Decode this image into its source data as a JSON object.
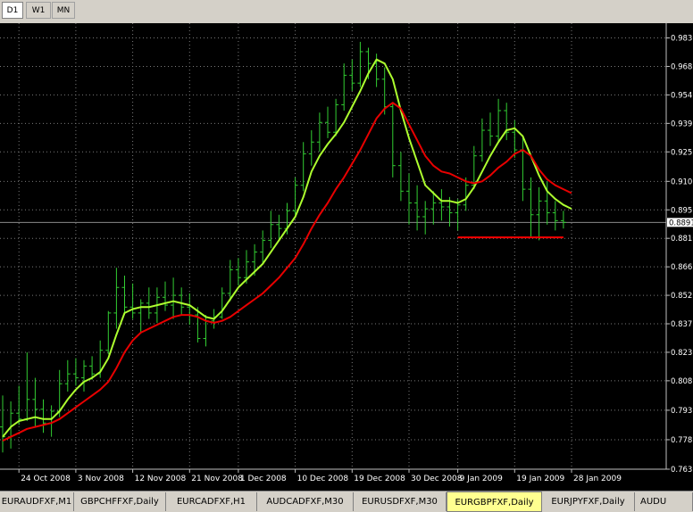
{
  "toolbar": {
    "timeframes": [
      {
        "label": "D1",
        "active": true
      },
      {
        "label": "W1",
        "active": false
      },
      {
        "label": "MN",
        "active": false
      }
    ]
  },
  "chart_data": {
    "type": "line",
    "symbol": "EURGBPFXF",
    "period": "Daily",
    "current_price": "0.8891",
    "ylim": [
      0.7635,
      0.9905
    ],
    "y_ticks": [
      "0.9830",
      "0.9685",
      "0.9540",
      "0.9395",
      "0.9250",
      "0.9100",
      "0.8955",
      "0.8810",
      "0.8665",
      "0.8520",
      "0.8375",
      "0.8230",
      "0.8085",
      "0.7935",
      "0.7785",
      "0.7635"
    ],
    "x_ticks": [
      {
        "bar": 2,
        "label": "24 Oct 2008"
      },
      {
        "bar": 9,
        "label": "3 Nov 2008"
      },
      {
        "bar": 16,
        "label": "12 Nov 2008"
      },
      {
        "bar": 23,
        "label": "21 Nov 2008"
      },
      {
        "bar": 29,
        "label": "1 Dec 2008"
      },
      {
        "bar": 36,
        "label": "10 Dec 2008"
      },
      {
        "bar": 43,
        "label": "19 Dec 2008"
      },
      {
        "bar": 50,
        "label": "30 Dec 2008"
      },
      {
        "bar": 56,
        "label": "9 Jan 2009"
      },
      {
        "bar": 63,
        "label": "19 Jan 2009"
      },
      {
        "bar": 70,
        "label": "28 Jan 2009"
      }
    ],
    "candles": [
      [
        0.785,
        0.801,
        0.772,
        0.78
      ],
      [
        0.78,
        0.798,
        0.774,
        0.792
      ],
      [
        0.792,
        0.806,
        0.786,
        0.789
      ],
      [
        0.789,
        0.823,
        0.788,
        0.799
      ],
      [
        0.799,
        0.81,
        0.785,
        0.794
      ],
      [
        0.794,
        0.799,
        0.782,
        0.787
      ],
      [
        0.787,
        0.796,
        0.78,
        0.793
      ],
      [
        0.793,
        0.814,
        0.79,
        0.807
      ],
      [
        0.807,
        0.819,
        0.803,
        0.812
      ],
      [
        0.812,
        0.82,
        0.806,
        0.81
      ],
      [
        0.81,
        0.819,
        0.803,
        0.816
      ],
      [
        0.816,
        0.821,
        0.809,
        0.812
      ],
      [
        0.812,
        0.829,
        0.81,
        0.824
      ],
      [
        0.824,
        0.844,
        0.822,
        0.843
      ],
      [
        0.843,
        0.866,
        0.835,
        0.856
      ],
      [
        0.856,
        0.862,
        0.842,
        0.846
      ],
      [
        0.846,
        0.858,
        0.84,
        0.843
      ],
      [
        0.843,
        0.85,
        0.833,
        0.848
      ],
      [
        0.848,
        0.856,
        0.84,
        0.843
      ],
      [
        0.843,
        0.856,
        0.838,
        0.851
      ],
      [
        0.851,
        0.859,
        0.844,
        0.847
      ],
      [
        0.847,
        0.861,
        0.84,
        0.852
      ],
      [
        0.852,
        0.856,
        0.842,
        0.846
      ],
      [
        0.846,
        0.853,
        0.837,
        0.842
      ],
      [
        0.842,
        0.846,
        0.828,
        0.83
      ],
      [
        0.83,
        0.842,
        0.826,
        0.839
      ],
      [
        0.839,
        0.845,
        0.835,
        0.841
      ],
      [
        0.841,
        0.856,
        0.84,
        0.853
      ],
      [
        0.853,
        0.87,
        0.849,
        0.865
      ],
      [
        0.865,
        0.871,
        0.857,
        0.861
      ],
      [
        0.861,
        0.875,
        0.858,
        0.869
      ],
      [
        0.869,
        0.878,
        0.862,
        0.874
      ],
      [
        0.874,
        0.885,
        0.868,
        0.88
      ],
      [
        0.88,
        0.895,
        0.876,
        0.888
      ],
      [
        0.888,
        0.893,
        0.88,
        0.886
      ],
      [
        0.886,
        0.899,
        0.883,
        0.895
      ],
      [
        0.895,
        0.912,
        0.893,
        0.908
      ],
      [
        0.908,
        0.93,
        0.905,
        0.924
      ],
      [
        0.924,
        0.936,
        0.918,
        0.93
      ],
      [
        0.93,
        0.945,
        0.925,
        0.94
      ],
      [
        0.94,
        0.948,
        0.932,
        0.935
      ],
      [
        0.935,
        0.952,
        0.933,
        0.949
      ],
      [
        0.949,
        0.97,
        0.946,
        0.964
      ],
      [
        0.964,
        0.972,
        0.956,
        0.96
      ],
      [
        0.96,
        0.981,
        0.958,
        0.976
      ],
      [
        0.976,
        0.978,
        0.962,
        0.97
      ],
      [
        0.97,
        0.975,
        0.958,
        0.962
      ],
      [
        0.962,
        0.968,
        0.944,
        0.948
      ],
      [
        0.948,
        0.95,
        0.912,
        0.918
      ],
      [
        0.918,
        0.925,
        0.9,
        0.905
      ],
      [
        0.905,
        0.914,
        0.888,
        0.899
      ],
      [
        0.899,
        0.908,
        0.885,
        0.892
      ],
      [
        0.892,
        0.9,
        0.883,
        0.896
      ],
      [
        0.896,
        0.905,
        0.888,
        0.899
      ],
      [
        0.899,
        0.906,
        0.89,
        0.897
      ],
      [
        0.897,
        0.902,
        0.887,
        0.894
      ],
      [
        0.894,
        0.901,
        0.885,
        0.898
      ],
      [
        0.898,
        0.912,
        0.895,
        0.908
      ],
      [
        0.908,
        0.928,
        0.906,
        0.923
      ],
      [
        0.923,
        0.942,
        0.92,
        0.936
      ],
      [
        0.936,
        0.945,
        0.928,
        0.933
      ],
      [
        0.933,
        0.952,
        0.93,
        0.946
      ],
      [
        0.946,
        0.95,
        0.931,
        0.935
      ],
      [
        0.935,
        0.941,
        0.922,
        0.926
      ],
      [
        0.926,
        0.933,
        0.9,
        0.906
      ],
      [
        0.906,
        0.912,
        0.882,
        0.893
      ],
      [
        0.893,
        0.907,
        0.88,
        0.9
      ],
      [
        0.9,
        0.91,
        0.888,
        0.894
      ],
      [
        0.894,
        0.9,
        0.885,
        0.89
      ],
      [
        0.89,
        0.895,
        0.886,
        0.8891
      ]
    ],
    "series": [
      {
        "color": "#adff2f",
        "values": [
          0.78,
          0.785,
          0.788,
          0.789,
          0.79,
          0.789,
          0.789,
          0.793,
          0.799,
          0.804,
          0.808,
          0.81,
          0.813,
          0.82,
          0.832,
          0.843,
          0.845,
          0.846,
          0.846,
          0.847,
          0.848,
          0.849,
          0.848,
          0.847,
          0.844,
          0.841,
          0.84,
          0.844,
          0.85,
          0.856,
          0.86,
          0.864,
          0.868,
          0.874,
          0.88,
          0.886,
          0.892,
          0.902,
          0.915,
          0.923,
          0.929,
          0.934,
          0.94,
          0.948,
          0.956,
          0.965,
          0.972,
          0.97,
          0.962,
          0.946,
          0.932,
          0.92,
          0.908,
          0.904,
          0.9,
          0.9,
          0.899,
          0.901,
          0.907,
          0.915,
          0.923,
          0.93,
          0.936,
          0.937,
          0.933,
          0.923,
          0.913,
          0.905,
          0.901,
          0.898,
          0.896
        ]
      },
      {
        "color": "#e80000",
        "values": [
          0.778,
          0.78,
          0.782,
          0.784,
          0.785,
          0.786,
          0.787,
          0.789,
          0.792,
          0.795,
          0.798,
          0.801,
          0.804,
          0.808,
          0.815,
          0.823,
          0.829,
          0.833,
          0.835,
          0.837,
          0.839,
          0.841,
          0.842,
          0.842,
          0.841,
          0.839,
          0.838,
          0.839,
          0.841,
          0.844,
          0.847,
          0.85,
          0.853,
          0.857,
          0.861,
          0.866,
          0.871,
          0.878,
          0.886,
          0.893,
          0.899,
          0.906,
          0.912,
          0.919,
          0.926,
          0.934,
          0.942,
          0.947,
          0.95,
          0.947,
          0.939,
          0.931,
          0.923,
          0.918,
          0.915,
          0.914,
          0.912,
          0.91,
          0.909,
          0.91,
          0.913,
          0.917,
          0.92,
          0.924,
          0.926,
          0.923,
          0.916,
          0.911,
          0.908,
          0.906,
          0.904
        ]
      }
    ],
    "annotation_line": {
      "color": "#ff0000",
      "y": 0.8815,
      "x_start_bar": 56,
      "x_end_bar": 69
    }
  },
  "tabs": [
    {
      "label": "EURAUDFXF,M1",
      "active": false
    },
    {
      "label": "GBPCHFFXF,Daily",
      "active": false
    },
    {
      "label": "EURCADFXF,H1",
      "active": false
    },
    {
      "label": "AUDCADFXF,M30",
      "active": false
    },
    {
      "label": "EURUSDFXF,M30",
      "active": false
    },
    {
      "label": "EURGBPFXF,Daily",
      "active": true
    },
    {
      "label": "EURJPYFXF,Daily",
      "active": false
    },
    {
      "label": "AUDU",
      "active": false
    }
  ]
}
